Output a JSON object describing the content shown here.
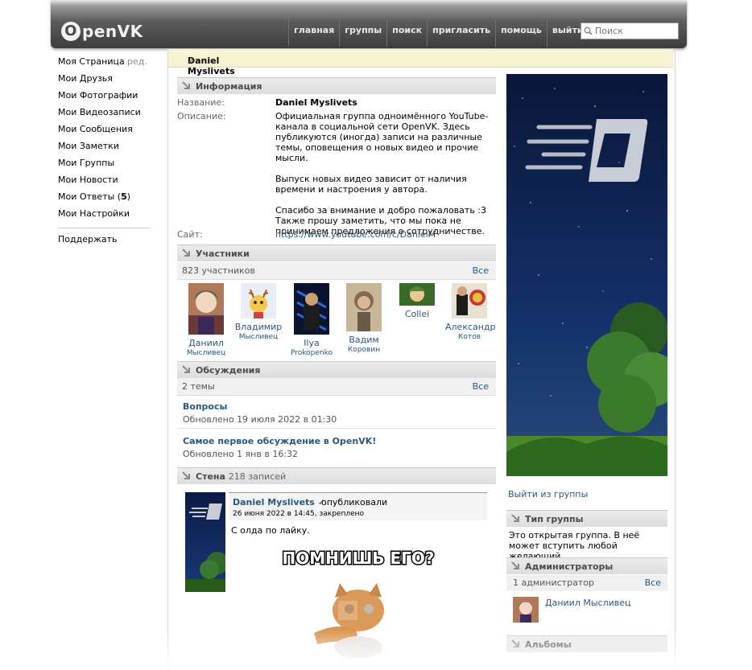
{
  "header": {
    "logo": "penVK",
    "logo_o": "O",
    "nav": [
      "главная",
      "группы",
      "поиск",
      "пригласить",
      "помощь",
      "выйти"
    ],
    "search_placeholder": "Поиск"
  },
  "sidebar": {
    "items": [
      {
        "label": "Моя Страница",
        "extra": "ред."
      },
      {
        "label": "Мои Друзья"
      },
      {
        "label": "Мои Фотографии"
      },
      {
        "label": "Мои Видеозаписи"
      },
      {
        "label": "Мои Сообщения"
      },
      {
        "label": "Мои Заметки"
      },
      {
        "label": "Мои Группы"
      },
      {
        "label": "Мои Новости"
      },
      {
        "label": "Мои Ответы",
        "count": "5"
      },
      {
        "label": "Мои Настройки"
      }
    ],
    "support": "Поддержать"
  },
  "page": {
    "title": "Daniel Myslivets",
    "verified_mark": "✓"
  },
  "info": {
    "header": "Информация",
    "name_label": "Название:",
    "name_value": "Daniel Myslivets",
    "desc_label": "Описание:",
    "desc_p1": "Официальная группа одноимённого YouTube-канала в социальной сети OpenVK. Здесь публикуются (иногда) записи на различные темы, оповещения о новых видео и прочие мысли.",
    "desc_p2": "Выпуск новых видео зависит от наличия времени и настроения у автора.",
    "desc_p3a": "Спасибо за внимание и добро пожаловать :3",
    "desc_p3b": "Также прошу заметить, что мы пока не принимаем предложения о сотрудничестве.",
    "site_label": "Сайт:",
    "site_value": "https://www.youtube.com/c/DanielM"
  },
  "members": {
    "header": "Участники",
    "count": "823 участников",
    "all": "Все",
    "list": [
      {
        "first": "Даниил",
        "last": "Мысливец"
      },
      {
        "first": "Владимир",
        "last": "Мысливец"
      },
      {
        "first": "Ilya",
        "last": "Prokopenko"
      },
      {
        "first": "Вадим",
        "last": "Коровин"
      },
      {
        "first": "Collei",
        "last": ""
      },
      {
        "first": "Александр",
        "last": "Котов"
      }
    ]
  },
  "discussions": {
    "header": "Обсуждения",
    "count": "2 темы",
    "all": "Все",
    "topics": [
      {
        "title": "Вопросы",
        "updated": "Обновлено 19 июля 2022 в 01:30"
      },
      {
        "title": "Самое первое обсуждение в OpenVK!",
        "updated": "Обновлено 1 янв в 16:32"
      }
    ]
  },
  "wall": {
    "header": "Стена",
    "count": "218 записей",
    "post": {
      "author": "Daniel Myslivets",
      "verb": "опубликовали",
      "date": "26 июня 2022 в 14:45",
      "pinned": ", закреплено",
      "text": "С олда по лайку.",
      "meme_caption": "ПОМНИШЬ ЕГО?"
    }
  },
  "right": {
    "leave": "Выйти из группы",
    "type_header": "Тип группы",
    "type_text": "Это открытая группа. В неё может вступить любой желающий.",
    "admins_header": "Администраторы",
    "admins_count": "1 администратор",
    "admins_all": "Все",
    "admin_name": "Даниил Мысливец",
    "albums_header": "Альбомы"
  }
}
